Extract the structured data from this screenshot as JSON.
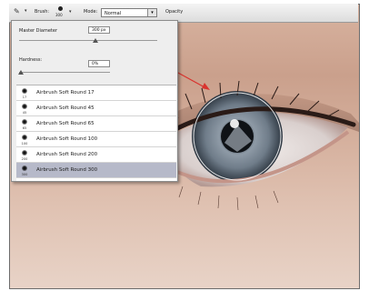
{
  "options_bar": {
    "brush_label": "Brush:",
    "brush_size": "300",
    "mode_label": "Mode:",
    "mode_value": "Normal",
    "opacity_label": "Opacity"
  },
  "brush_panel": {
    "master_diameter_label": "Master Diameter",
    "master_diameter_value": "300 px",
    "master_diameter_fraction": 0.55,
    "hardness_label": "Hardness:",
    "hardness_value": "0%",
    "hardness_fraction": 0.0,
    "presets": [
      {
        "name": "Airbrush Soft Round 17",
        "size": "17"
      },
      {
        "name": "Airbrush Soft Round 45",
        "size": "45"
      },
      {
        "name": "Airbrush Soft Round 65",
        "size": "65"
      },
      {
        "name": "Airbrush Soft Round 100",
        "size": "100"
      },
      {
        "name": "Airbrush Soft Round 200",
        "size": "200"
      },
      {
        "name": "Airbrush Soft Round 300",
        "size": "300",
        "selected": true
      }
    ]
  },
  "colors": {
    "annotation_arrow": "#d9332e",
    "selected_row": "#b6b9c9",
    "panel_bg": "#eeeeee"
  },
  "icons": {
    "tool": "brush-tool-icon",
    "preset": "airbrush-soft-round-icon"
  }
}
